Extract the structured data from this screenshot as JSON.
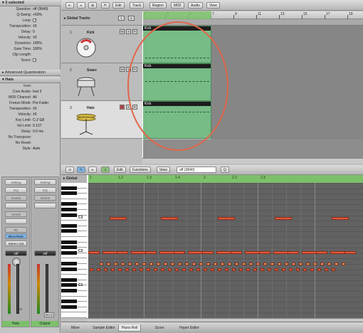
{
  "inspector": {
    "region_header": "3 selected",
    "region_params": [
      {
        "k": "Quantize:",
        "v": "off (3840)"
      },
      {
        "k": "Q-Swing:",
        "v": "+50%"
      },
      {
        "k": "Loop:",
        "v": "check"
      },
      {
        "k": "Transposition:",
        "v": "±0"
      },
      {
        "k": "Delay:",
        "v": "0"
      },
      {
        "k": "Velocity:",
        "v": "±0"
      },
      {
        "k": "Dynamics:",
        "v": "100%"
      },
      {
        "k": "Gate Time:",
        "v": "100%"
      },
      {
        "k": "Clip Length:",
        "v": ""
      },
      {
        "k": "Score:",
        "v": "check"
      }
    ],
    "adv_quant": "Advanced Quantization",
    "track_header": "Hats",
    "track_params": [
      {
        "k": "Icon:",
        "v": ""
      },
      {
        "k": "Core Audio:",
        "v": "Inst 3"
      },
      {
        "k": "MIDI Channel:",
        "v": "All"
      },
      {
        "k": "Freeze Mode:",
        "v": "Pre Fader"
      },
      {
        "k": "Transposition:",
        "v": "±0"
      },
      {
        "k": "Velocity:",
        "v": "±0"
      },
      {
        "k": "Key Limit:",
        "v": "C-2  G8"
      },
      {
        "k": "Vel Limit:",
        "v": "0     127"
      },
      {
        "k": "Delay:",
        "v": "0.0 ms"
      },
      {
        "k": "No Transpose:",
        "v": ""
      },
      {
        "k": "No Reset:",
        "v": ""
      },
      {
        "k": "Style:",
        "v": "Auto"
      }
    ],
    "strip_left": {
      "setting": "Setting",
      "eq": "EQ",
      "inserts": "Inserts",
      "sends": "Sends",
      "io": "I/O",
      "plugin": "MicroTonic",
      "output": "Stereo Out",
      "off": "Off",
      "name": "Hats",
      "pan": "0"
    },
    "strip_right": {
      "setting": "Setting",
      "eq": "EQ",
      "inserts": "Inserts",
      "off": "Off",
      "name": "Output",
      "bnce": "Bnce"
    }
  },
  "toolbar": {
    "edit": "Edit",
    "track": "Track",
    "region": "Region",
    "midi": "MIDI",
    "audio": "Audio",
    "view": "View"
  },
  "global_tracks": "Global Tracks",
  "ruler_ticks": [
    "1",
    "3",
    "5",
    "7",
    "9",
    "11",
    "13",
    "15",
    "17",
    "19"
  ],
  "tracks": [
    {
      "num": "1",
      "name": "Kick",
      "region": "Kick"
    },
    {
      "num": "2",
      "name": "Snare",
      "region": "Kick"
    },
    {
      "num": "3",
      "name": "Hats",
      "region": "Kick"
    }
  ],
  "piano_roll": {
    "edit": "Edit",
    "functions": "Functions",
    "view": "View",
    "quantize": "off (3840)",
    "global": "Global",
    "ruler_ticks": [
      "1",
      "1.2",
      "1.3",
      "1.4",
      "2",
      "2.2",
      "2.3"
    ],
    "octave_labels": [
      "C3",
      "C2",
      "C1"
    ]
  },
  "tabs": [
    "Mixer",
    "Sample Editor",
    "Piano Roll",
    "Score",
    "Hyper Editor"
  ],
  "colors": {
    "region": "#77bb86",
    "note": "#e35a3c",
    "annotation": "#e0664a",
    "strip_name": "#7dc06a"
  }
}
